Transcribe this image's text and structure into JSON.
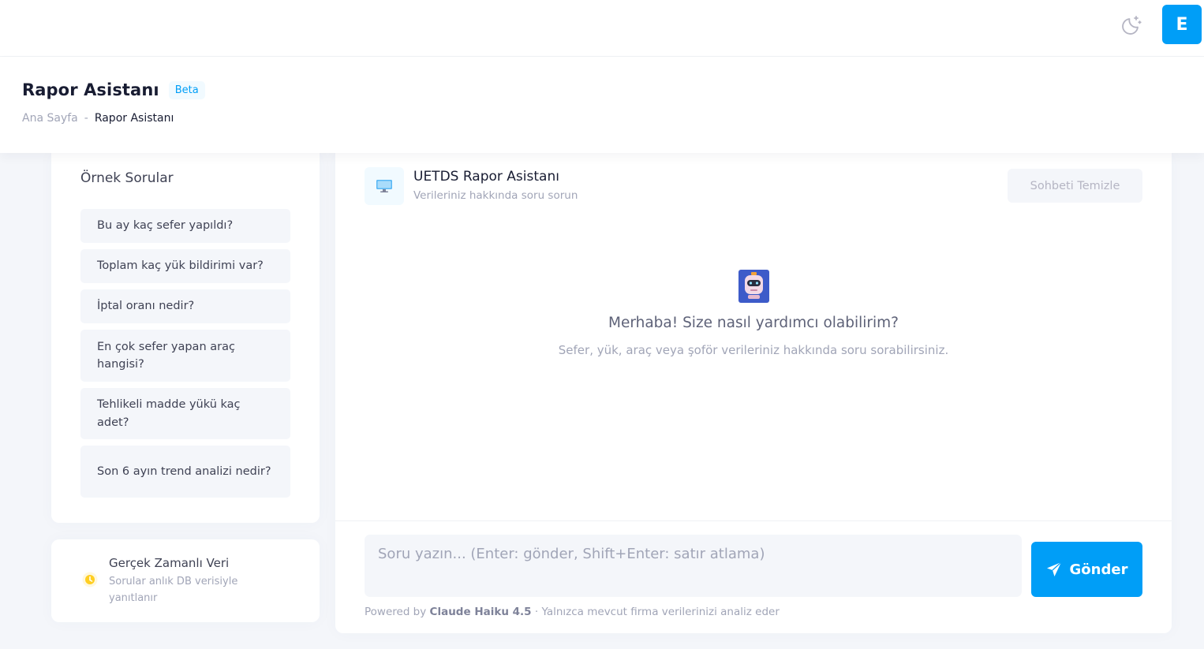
{
  "header": {
    "theme_icon": "moon-stars-icon",
    "avatar_initial": "E"
  },
  "toolbar": {
    "title": "Rapor Asistanı",
    "badge": "Beta",
    "breadcrumb": {
      "home": "Ana Sayfa",
      "separator": "-",
      "current": "Rapor Asistanı"
    }
  },
  "samples": {
    "title": "Örnek Sorular",
    "items": [
      {
        "label": "Bu ay kaç sefer yapıldı?"
      },
      {
        "label": "Toplam kaç yük bildirimi var?"
      },
      {
        "label": "İptal oranı nedir?"
      },
      {
        "label": "En çok sefer yapan araç hangisi?"
      },
      {
        "label": "Tehlikeli madde yükü kaç adet?"
      },
      {
        "label": "Son 6 ayın trend analizi nedir?"
      }
    ]
  },
  "realtime": {
    "icon": "clock-icon",
    "title": "Gerçek Zamanlı Veri",
    "description": "Sorular anlık DB verisiyle yanıtlanır"
  },
  "chat": {
    "header_icon": "monitor-icon",
    "title": "UETDS Rapor Asistanı",
    "subtitle": "Verileriniz hakkında soru sorun",
    "clear_label": "Sohbeti Temizle",
    "welcome_title": "Merhaba! Size nasıl yardımcı olabilirim?",
    "welcome_subtitle": "Sefer, yük, araç veya şoför verileriniz hakkında soru sorabilirsiniz.",
    "input_value": "",
    "input_placeholder": "Soru yazın... (Enter: gönder, Shift+Enter: satır atlama)",
    "send_label": "Gönder",
    "powered_prefix": "Powered by",
    "powered_model": "Claude Haiku 4.5",
    "powered_suffix": "· Yalnızca mevcut firma verilerinizi analiz eder"
  },
  "colors": {
    "primary": "#009ef7",
    "page_bg": "#f4f6fa",
    "muted": "#a1a5b7",
    "heading": "#181c32"
  }
}
